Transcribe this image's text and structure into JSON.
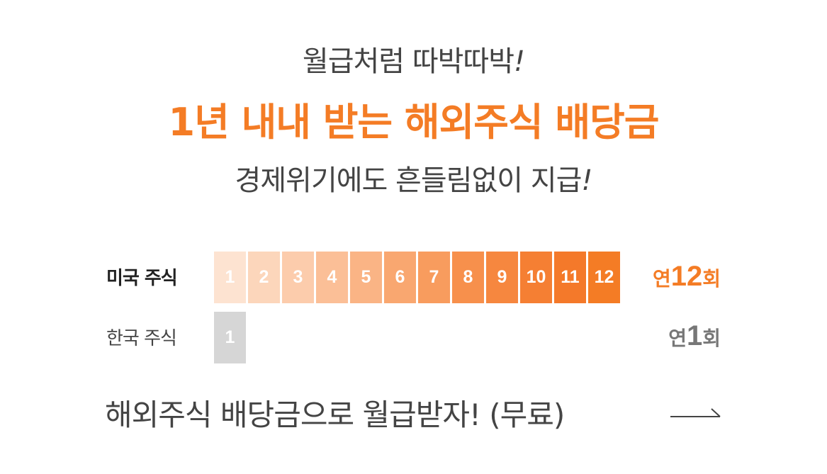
{
  "headline": {
    "line1": "월급처럼 따박따박",
    "line1_mark": "!",
    "line2": "1년 내내 받는 해외주식 배당금",
    "line3": "경제위기에도 흔들림없이 지급",
    "line3_mark": "!"
  },
  "comparison": {
    "us": {
      "label": "미국 주식",
      "months": [
        "1",
        "2",
        "3",
        "4",
        "5",
        "6",
        "7",
        "8",
        "9",
        "10",
        "11",
        "12"
      ],
      "freq_prefix": "연",
      "freq_count": "12",
      "freq_suffix": "회"
    },
    "kr": {
      "label": "한국 주식",
      "months": [
        "1"
      ],
      "freq_prefix": "연",
      "freq_count": "1",
      "freq_suffix": "회"
    }
  },
  "cta": {
    "label": "해외주식 배당금으로 월급받자! (무료)"
  },
  "colors": {
    "accent": "#f47c25",
    "us_cells": [
      "#fde3d1",
      "#fcd6bb",
      "#fcccac",
      "#fbbf97",
      "#fab485",
      "#f9a770",
      "#f89c5e",
      "#f7904c",
      "#f6873f",
      "#f57f33",
      "#f4792a",
      "#f47c25"
    ],
    "kr_cell": "#d6d6d6"
  },
  "icons": {
    "cta_arrow": "long-right-arrow-icon"
  }
}
